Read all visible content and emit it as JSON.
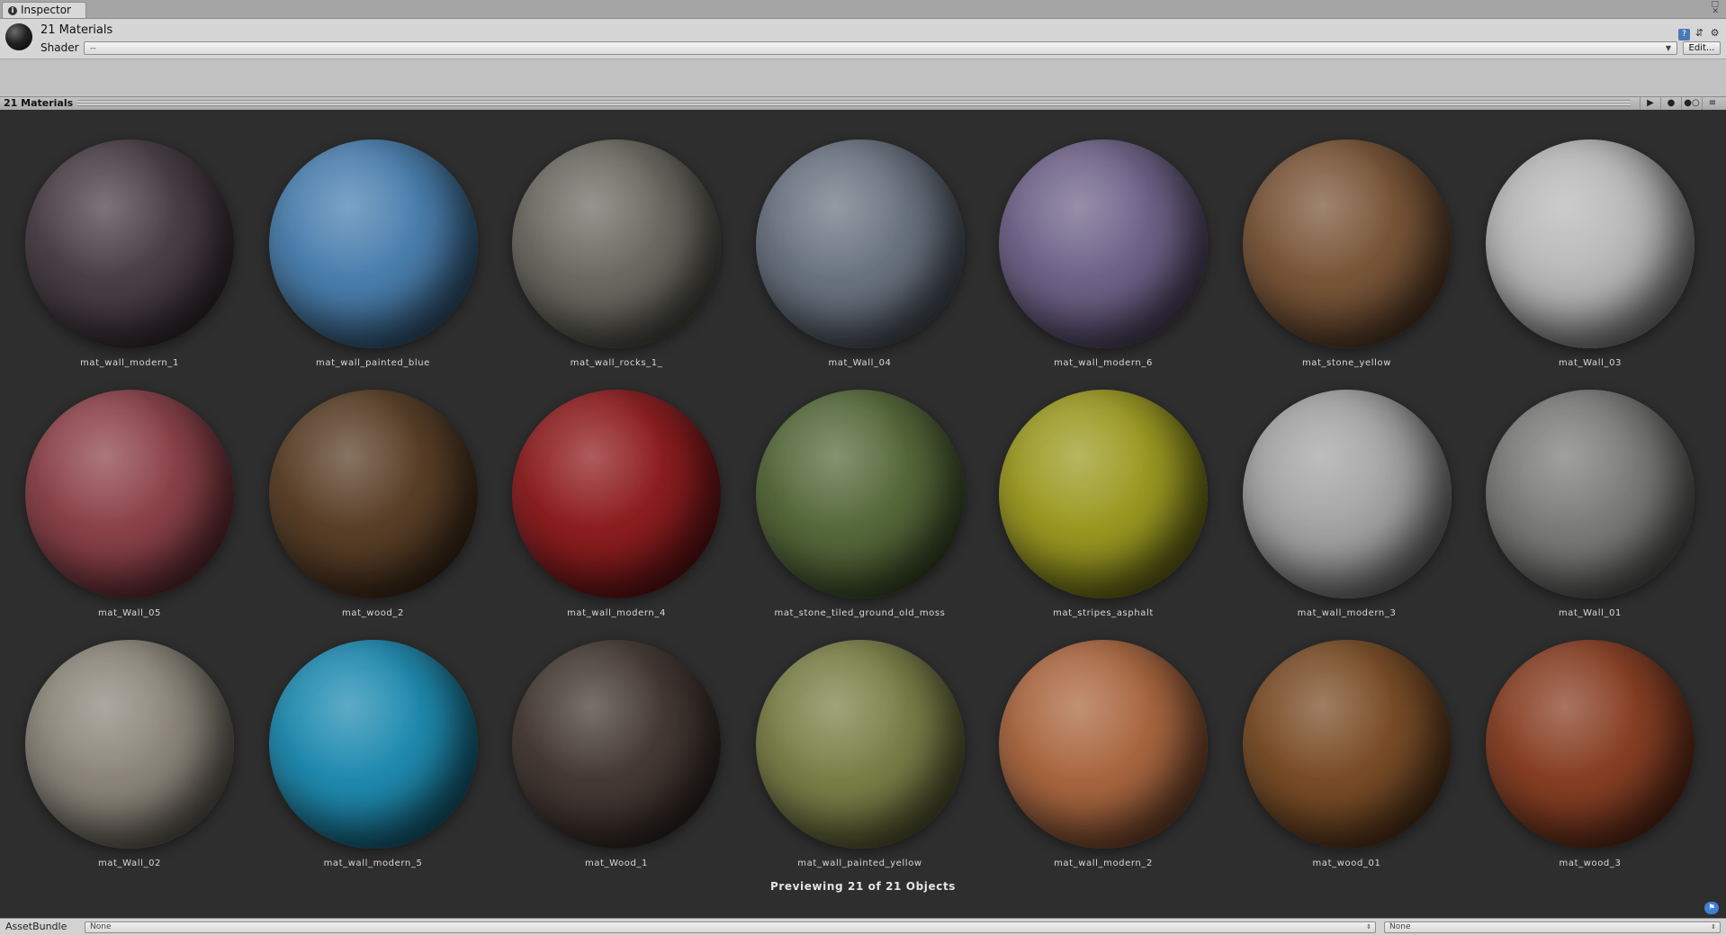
{
  "window": {
    "tab_label": "Inspector",
    "tab_icon": "info-icon"
  },
  "header": {
    "title": "21 Materials",
    "shader_label": "Shader",
    "shader_value": "--",
    "edit_label": "Edit..."
  },
  "preview": {
    "title": "21 Materials",
    "status": "Previewing 21 of 21 Objects",
    "buttons": [
      "play-icon",
      "sphere-icon",
      "lights-icon",
      "menu-icon"
    ]
  },
  "materials": [
    {
      "name": "mat_wall_modern_1",
      "color": "#4a3f46"
    },
    {
      "name": "mat_wall_painted_blue",
      "color": "#4a7fae"
    },
    {
      "name": "mat_wall_rocks_1_",
      "color": "#6c6b62"
    },
    {
      "name": "mat_Wall_04",
      "color": "#6a7481"
    },
    {
      "name": "mat_wall_modern_6",
      "color": "#6f6389"
    },
    {
      "name": "mat_stone_yellow",
      "color": "#7a5638"
    },
    {
      "name": "mat_Wall_03",
      "color": "#b8b8b8"
    },
    {
      "name": "mat_Wall_05",
      "color": "#8c4249"
    },
    {
      "name": "mat_wood_2",
      "color": "#5a3f27"
    },
    {
      "name": "mat_wall_modern_4",
      "color": "#8e1d1f"
    },
    {
      "name": "mat_stone_tiled_ground_old_moss",
      "color": "#566a3a"
    },
    {
      "name": "mat_stripes_asphalt",
      "color": "#9b9a22"
    },
    {
      "name": "mat_wall_modern_3",
      "color": "#a4a4a4"
    },
    {
      "name": "mat_Wall_01",
      "color": "#7c7c7a"
    },
    {
      "name": "mat_Wall_02",
      "color": "#8c877b"
    },
    {
      "name": "mat_wall_modern_5",
      "color": "#1f8bb0"
    },
    {
      "name": "mat_Wood_1",
      "color": "#463a34"
    },
    {
      "name": "mat_wall_painted_yellow",
      "color": "#7b8048"
    },
    {
      "name": "mat_wall_modern_2",
      "color": "#aa6740"
    },
    {
      "name": "mat_wood_01",
      "color": "#7a4d27"
    },
    {
      "name": "mat_wood_3",
      "color": "#883f24"
    }
  ],
  "footer": {
    "assetbundle_label": "AssetBundle",
    "bundle_value": "None",
    "variant_value": "None"
  }
}
